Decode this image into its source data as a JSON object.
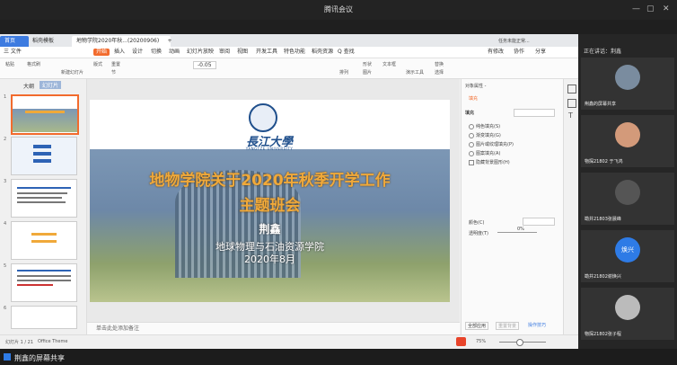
{
  "window": {
    "title": "腾讯会议",
    "controls": [
      "—",
      "▢",
      "✕"
    ]
  },
  "tabs": [
    {
      "label": "首页"
    },
    {
      "label": "稻壳模板"
    },
    {
      "label": "地物学院2020年秋...(20200906)"
    },
    {
      "label": "+"
    }
  ],
  "tabbar_right": {
    "window_label": "任务未能正常..."
  },
  "menu": {
    "file": "三 文件",
    "items": [
      "开始",
      "插入",
      "设计",
      "切换",
      "动画",
      "幻灯片放映",
      "审阅",
      "视图",
      "开发工具",
      "特色功能",
      "稻壳资源"
    ],
    "active": "开始",
    "search": "Q 查找",
    "right": [
      "有修改",
      "协作",
      "分享"
    ]
  },
  "toolbar": {
    "font_size": "-0.05",
    "buttons": [
      "粘贴",
      "格式刷",
      "新建幻灯片",
      "版式",
      "重置",
      "节",
      "排列",
      "形状",
      "图片",
      "文本框",
      "演示工具",
      "替换",
      "选择"
    ]
  },
  "sidebar": {
    "tabs": [
      "大纲",
      "幻灯片"
    ],
    "slide_numbers": [
      "1",
      "2",
      "3",
      "4",
      "5",
      "6"
    ]
  },
  "slide": {
    "logo_script": "長江大學",
    "logo_english": "YANGTZE UNIVERSITY",
    "title_line1": "地物学院关于2020年秋季开学工作",
    "title_line2": "主题班会",
    "presenter": "荆鑫",
    "department": "地球物理与石油资源学院",
    "date": "2020年8月"
  },
  "notes_placeholder": "单击此处添加备注",
  "right_panel": {
    "header": "对象属性 -",
    "tab_fill": "填充",
    "fill_label": "填充",
    "options": [
      "纯色填充(S)",
      "渐变填充(G)",
      "图片或纹理填充(P)",
      "图案填充(A)",
      "隐藏背景图形(H)"
    ],
    "color_label": "颜色(C)",
    "transparency_label": "透明度(T)",
    "transparency_value": "0%",
    "buttons": [
      "全部应用",
      "重置背景",
      "操作技巧"
    ]
  },
  "statusbar": {
    "slide_count": "幻灯片 1 / 21",
    "theme": "Office Theme",
    "zoom": "75%"
  },
  "participants": {
    "speaking_label": "正在讲话：荆鑫",
    "people": [
      {
        "name": "荆鑫的屏幕共享",
        "color": "#7a8c9f"
      },
      {
        "name": "物探21802 于飞鸿",
        "color": "#d39a7a"
      },
      {
        "name": "勘井21803张晨峰",
        "color": "#555555"
      },
      {
        "name": "勘井21802谢焕兴",
        "label": "焕兴",
        "color": "#2e7be6"
      },
      {
        "name": "物探21802张子程",
        "color": "#bbbbbb"
      }
    ]
  },
  "bottom": {
    "sharing_text": "荆鑫的屏幕共享"
  }
}
